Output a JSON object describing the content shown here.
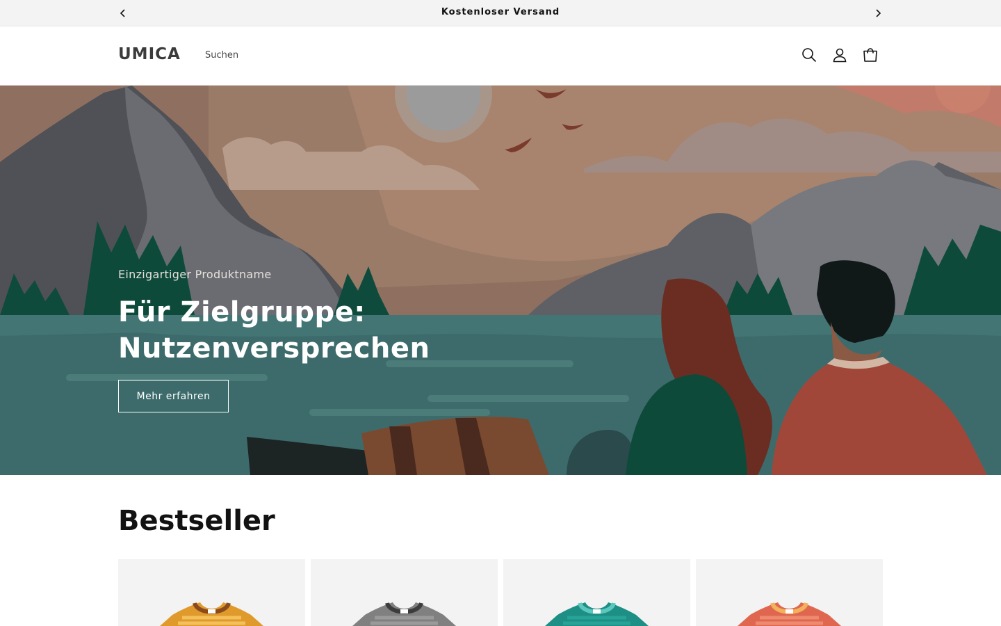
{
  "announcement": {
    "text": "Kostenloser Versand",
    "prev_icon": "chevron-left-icon",
    "next_icon": "chevron-right-icon"
  },
  "header": {
    "logo": "UMICA",
    "nav": [
      {
        "label": "Suchen"
      }
    ],
    "icons": [
      "search-icon",
      "account-icon",
      "cart-icon"
    ]
  },
  "hero": {
    "subheading": "Einzigartiger Produktname",
    "title": "Für Zielgruppe: Nutzenversprechen",
    "button_label": "Mehr erfahren"
  },
  "bestseller": {
    "title": "Bestseller",
    "products": [
      {
        "color": "#e09a2c",
        "collar": "#8a4a1e",
        "stripe": "#f3c05a"
      },
      {
        "color": "#808080",
        "collar": "#3c3c3c",
        "stripe": "#9a9a9a"
      },
      {
        "color": "#1e8f85",
        "collar": "#5cc7bd",
        "stripe": "#27a397"
      },
      {
        "color": "#e0674f",
        "collar": "#f2b15a",
        "stripe": "#ee8a6f"
      }
    ]
  },
  "colors": {
    "announcement_bg": "#f3f3f3",
    "text": "#121212",
    "hero_water": "#3d6b6b"
  }
}
